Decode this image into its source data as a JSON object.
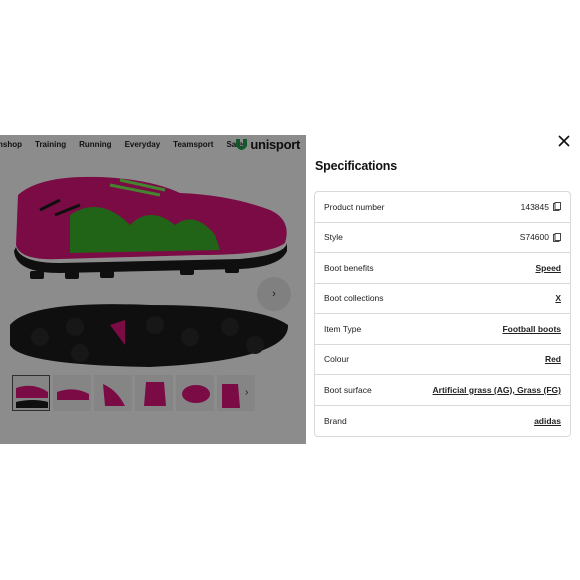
{
  "nav": {
    "items": [
      "nshop",
      "Training",
      "Running",
      "Everyday",
      "Teamsport",
      "Sale"
    ],
    "logo_text": "unisport"
  },
  "drawer": {
    "title": "Specifications",
    "specs": [
      {
        "label": "Product number",
        "value": "143845",
        "copy": true,
        "link": false
      },
      {
        "label": "Style",
        "value": "S74600",
        "copy": true,
        "link": false
      },
      {
        "label": "Boot benefits",
        "value": "Speed",
        "copy": false,
        "link": true
      },
      {
        "label": "Boot collections",
        "value": "X",
        "copy": false,
        "link": true
      },
      {
        "label": "Item Type",
        "value": "Football boots",
        "copy": false,
        "link": true
      },
      {
        "label": "Colour",
        "value": "Red",
        "copy": false,
        "link": true
      },
      {
        "label": "Boot surface",
        "value": "Artificial grass (AG), Grass (FG)",
        "copy": false,
        "link": true
      },
      {
        "label": "Brand",
        "value": "adidas",
        "copy": false,
        "link": true
      }
    ]
  },
  "icons": {
    "close": "close-icon",
    "next": "chevron-right-icon",
    "copy": "copy-icon"
  },
  "colors": {
    "boot_pink": "#e0157f",
    "boot_green": "#4fdc2c",
    "sole_black": "#1c1c1c",
    "logo_green": "#1fa24a"
  }
}
